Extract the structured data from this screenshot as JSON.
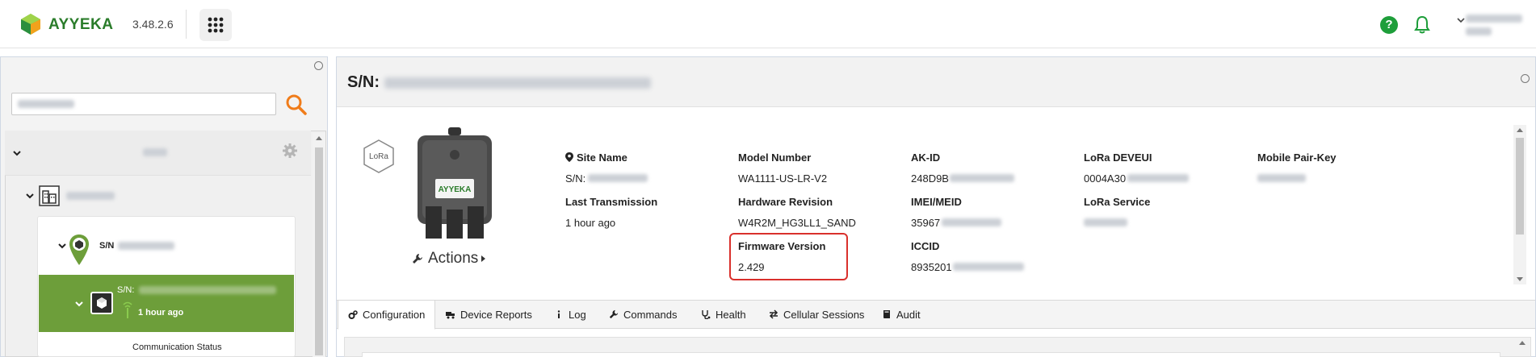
{
  "header": {
    "brand": "AYYEKA",
    "version": "3.48.2.6",
    "colors": {
      "brand_green": "#2a7c2a",
      "help_green": "#1e9e3a"
    }
  },
  "sidebar": {
    "search": {
      "value": "",
      "placeholder": ""
    },
    "tree": {
      "site_label": "S/N",
      "device": {
        "sn_label": "S/N:",
        "last_seen": "1 hour ago"
      },
      "child": {
        "label": "Communication Status"
      }
    },
    "colors": {
      "selected_row": "#6d9e3a"
    }
  },
  "main": {
    "title_prefix": "S/N:",
    "lora_badge": "LoRa",
    "device_label": "AYYEKA",
    "actions_label": "Actions",
    "fields": {
      "site_name": {
        "label": "Site Name",
        "value_prefix": "S/N:"
      },
      "last_transmission": {
        "label": "Last Transmission",
        "value": "1 hour ago"
      },
      "model_number": {
        "label": "Model Number",
        "value": "WA1111-US-LR-V2"
      },
      "hardware_revision": {
        "label": "Hardware Revision",
        "value": "W4R2M_HG3LL1_SAND"
      },
      "firmware_version": {
        "label": "Firmware Version",
        "value": "2.429"
      },
      "ak_id": {
        "label": "AK-ID",
        "value_prefix": "248D9B"
      },
      "imei_meid": {
        "label": "IMEI/MEID",
        "value_prefix": "35967"
      },
      "iccid": {
        "label": "ICCID",
        "value_prefix": "8935201"
      },
      "lora_deveui": {
        "label": "LoRa DEVEUI",
        "value_prefix": "0004A30"
      },
      "lora_service": {
        "label": "LoRa Service"
      },
      "mobile_pair_key": {
        "label": "Mobile Pair-Key"
      }
    },
    "highlight_color": "#d9302c",
    "tabs": [
      {
        "label": "Configuration",
        "icon": "gears-icon",
        "active": true
      },
      {
        "label": "Device Reports",
        "icon": "truck-icon",
        "active": false
      },
      {
        "label": "Log",
        "icon": "info-icon",
        "active": false
      },
      {
        "label": "Commands",
        "icon": "wrench-icon",
        "active": false
      },
      {
        "label": "Health",
        "icon": "stethoscope-icon",
        "active": false
      },
      {
        "label": "Cellular Sessions",
        "icon": "exchange-icon",
        "active": false
      },
      {
        "label": "Audit",
        "icon": "book-icon",
        "active": false
      }
    ]
  }
}
